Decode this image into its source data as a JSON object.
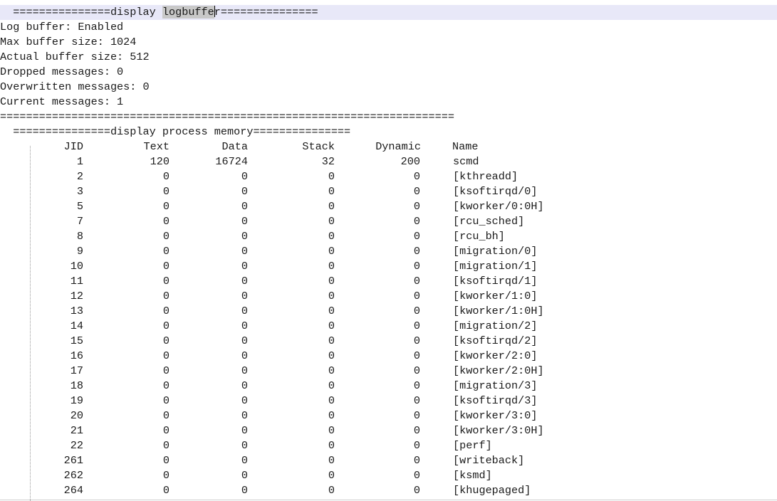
{
  "logbuffer": {
    "header_prefix": "  ===============display ",
    "header_highlight_a": "logbuff",
    "header_highlight_b": "e",
    "header_rest": "r===============",
    "lines": [
      "Log buffer: Enabled",
      "Max buffer size: 1024",
      "Actual buffer size: 512",
      "Dropped messages: 0",
      "Overwritten messages: 0",
      "Current messages: 1"
    ],
    "separator": "======================================================================"
  },
  "process_memory": {
    "header": "  ===============display process memory===============",
    "columns": [
      "JID",
      "Text",
      "Data",
      "Stack",
      "Dynamic",
      "Name"
    ],
    "rows": [
      [
        "1",
        "120",
        "16724",
        "32",
        "200",
        "scmd"
      ],
      [
        "2",
        "0",
        "0",
        "0",
        "0",
        "[kthreadd]"
      ],
      [
        "3",
        "0",
        "0",
        "0",
        "0",
        "[ksoftirqd/0]"
      ],
      [
        "5",
        "0",
        "0",
        "0",
        "0",
        "[kworker/0:0H]"
      ],
      [
        "7",
        "0",
        "0",
        "0",
        "0",
        "[rcu_sched]"
      ],
      [
        "8",
        "0",
        "0",
        "0",
        "0",
        "[rcu_bh]"
      ],
      [
        "9",
        "0",
        "0",
        "0",
        "0",
        "[migration/0]"
      ],
      [
        "10",
        "0",
        "0",
        "0",
        "0",
        "[migration/1]"
      ],
      [
        "11",
        "0",
        "0",
        "0",
        "0",
        "[ksoftirqd/1]"
      ],
      [
        "12",
        "0",
        "0",
        "0",
        "0",
        "[kworker/1:0]"
      ],
      [
        "13",
        "0",
        "0",
        "0",
        "0",
        "[kworker/1:0H]"
      ],
      [
        "14",
        "0",
        "0",
        "0",
        "0",
        "[migration/2]"
      ],
      [
        "15",
        "0",
        "0",
        "0",
        "0",
        "[ksoftirqd/2]"
      ],
      [
        "16",
        "0",
        "0",
        "0",
        "0",
        "[kworker/2:0]"
      ],
      [
        "17",
        "0",
        "0",
        "0",
        "0",
        "[kworker/2:0H]"
      ],
      [
        "18",
        "0",
        "0",
        "0",
        "0",
        "[migration/3]"
      ],
      [
        "19",
        "0",
        "0",
        "0",
        "0",
        "[ksoftirqd/3]"
      ],
      [
        "20",
        "0",
        "0",
        "0",
        "0",
        "[kworker/3:0]"
      ],
      [
        "21",
        "0",
        "0",
        "0",
        "0",
        "[kworker/3:0H]"
      ],
      [
        "22",
        "0",
        "0",
        "0",
        "0",
        "[perf]"
      ],
      [
        "261",
        "0",
        "0",
        "0",
        "0",
        "[writeback]"
      ],
      [
        "262",
        "0",
        "0",
        "0",
        "0",
        "[ksmd]"
      ],
      [
        "264",
        "0",
        "0",
        "0",
        "0",
        "[khugepaged]"
      ]
    ]
  }
}
